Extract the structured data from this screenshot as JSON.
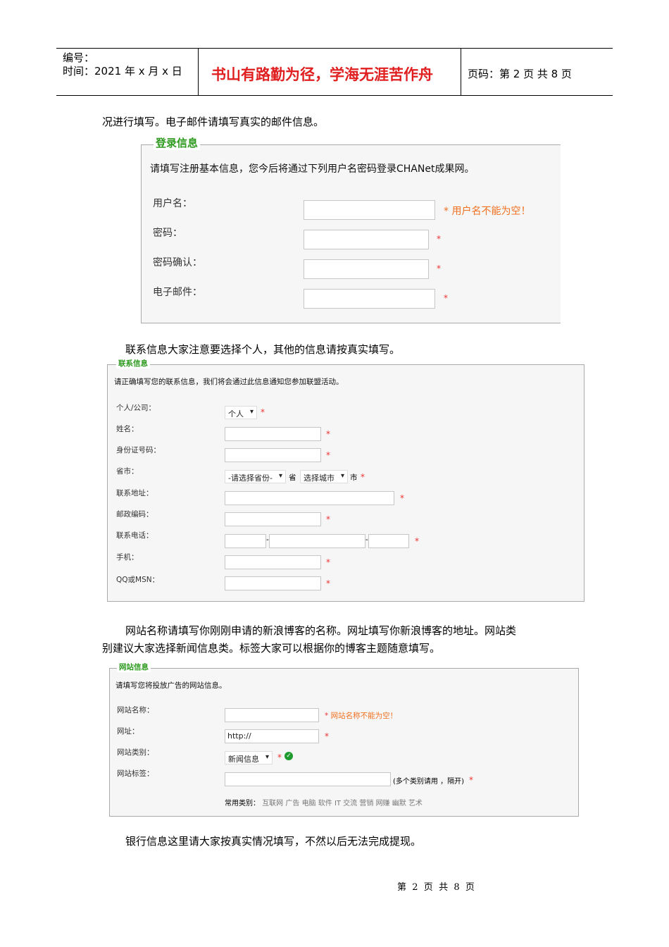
{
  "header": {
    "number_label": "编号：",
    "time_label": "时间：2021 年 x 月 x 日",
    "motto": "书山有路勤为径，学海无涯苦作舟",
    "page_label": "页码：第 2 页  共 8 页"
  },
  "paragraphs": [
    "况进行填写。电子邮件请填写真实的邮件信息。",
    "联系信息大家注意要选择个人，其他的信息请按真实填写。",
    "网站名称请填写你刚刚申请的新浪博客的名称。网址填写你新浪博客的地址。网站类",
    "别建议大家选择新闻信息类。标签大家可以根据你的博客主题随意填写。",
    "银行信息这里请大家按真实情况填写，不然以后无法完成提现。"
  ],
  "login": {
    "legend": "登录信息",
    "instruction": "请填写注册基本信息，您今后将通过下列用户名密码登录CHANet成果网。",
    "fields": [
      "用户名：",
      "密码：",
      "密码确认：",
      "电子邮件："
    ],
    "star": "*",
    "error": "用户名不能为空！"
  },
  "contact": {
    "legend": "联系信息",
    "instruction": "请正确填写您的联系信息，我们将会通过此信息通知您参加联盟活动。",
    "fields": [
      "个人/公司：",
      "姓名：",
      "身份证号码：",
      "省市：",
      "联系地址：",
      "邮政编码：",
      "联系电话：",
      "手机：",
      "QQ或MSN："
    ],
    "type_value": "个人",
    "province_value": "-请选择省份-",
    "province_suffix": "省",
    "city_value": "选择城市",
    "city_suffix": "市",
    "phone_sep": "-"
  },
  "website": {
    "legend": "网站信息",
    "instruction": "请填写您将投放广告的网站信息。",
    "fields": [
      "网站名称：",
      "网址：",
      "网站类别：",
      "网站标签："
    ],
    "name_error": "网站名称不能为空！",
    "url_value": "http://",
    "category_value": "新闻信息",
    "tag_hint": "(多个类别请用 ，隔开)",
    "common_label": "常用类别：",
    "common_tags": [
      "互联网",
      "广告",
      "电脑",
      "软件",
      "IT 交流",
      "营销",
      "网赚",
      "幽默",
      "艺术"
    ]
  },
  "footer": {
    "page": "第  2  页  共  8  页"
  }
}
